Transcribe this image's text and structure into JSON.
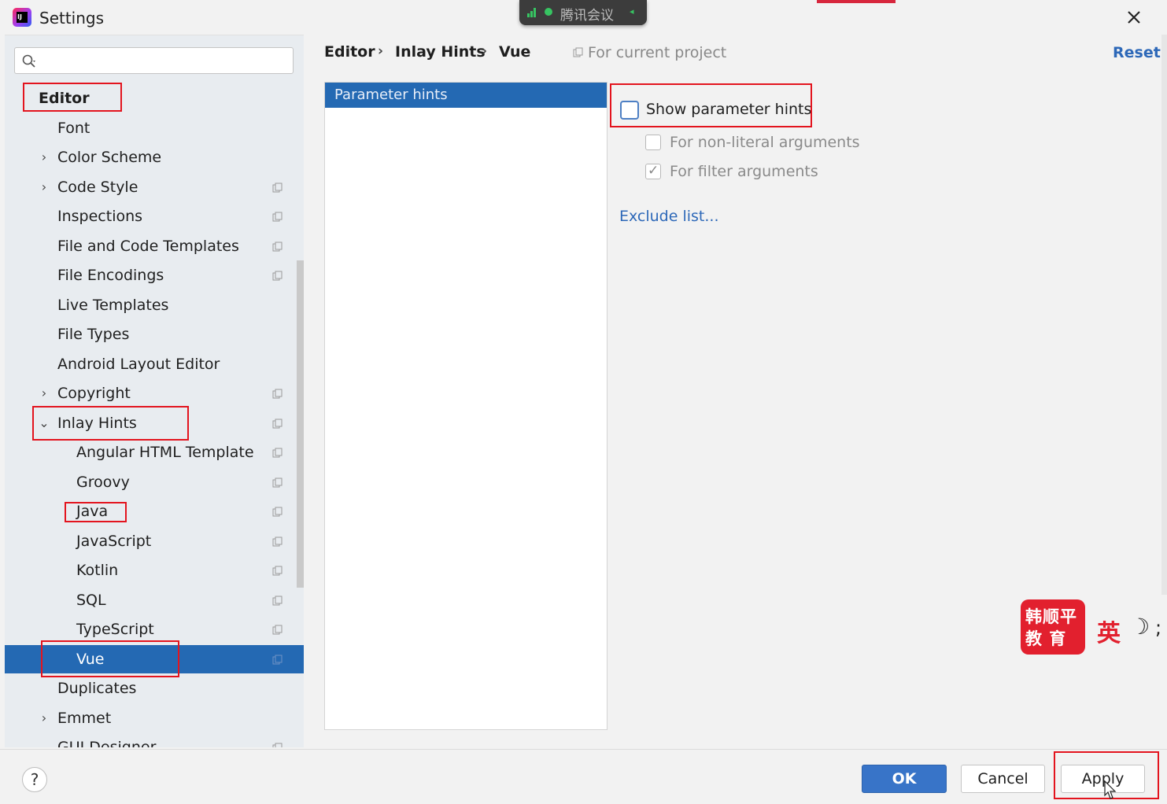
{
  "window": {
    "title": "Settings"
  },
  "meeting_indicator": {
    "text": "腾讯会议"
  },
  "sidebar": {
    "search_placeholder": "",
    "items": [
      {
        "label": "Editor"
      },
      {
        "label": "Font"
      },
      {
        "label": "Color Scheme"
      },
      {
        "label": "Code Style"
      },
      {
        "label": "Inspections"
      },
      {
        "label": "File and Code Templates"
      },
      {
        "label": "File Encodings"
      },
      {
        "label": "Live Templates"
      },
      {
        "label": "File Types"
      },
      {
        "label": "Android Layout Editor"
      },
      {
        "label": "Copyright"
      },
      {
        "label": "Inlay Hints"
      },
      {
        "label": "Angular HTML Template"
      },
      {
        "label": "Groovy"
      },
      {
        "label": "Java"
      },
      {
        "label": "JavaScript"
      },
      {
        "label": "Kotlin"
      },
      {
        "label": "SQL"
      },
      {
        "label": "TypeScript"
      },
      {
        "label": "Vue"
      },
      {
        "label": "Duplicates"
      },
      {
        "label": "Emmet"
      },
      {
        "label": "GUI Designer"
      }
    ]
  },
  "breadcrumb": {
    "items": [
      "Editor",
      "Inlay Hints",
      "Vue"
    ],
    "separator": "›"
  },
  "scope_label": "For current project",
  "reset_label": "Reset",
  "hint_list": {
    "items": [
      "Parameter hints"
    ],
    "selected": "Parameter hints"
  },
  "options": {
    "show_parameter_hints": {
      "label": "Show parameter hints",
      "checked": false
    },
    "non_literal": {
      "label": "For non-literal arguments",
      "checked": false
    },
    "filter_args": {
      "label": "For filter arguments",
      "checked": true
    },
    "exclude_list": "Exclude list..."
  },
  "watermark": {
    "line1": "韩顺平",
    "line2": "教 育",
    "ying": "英",
    "moon": "☽",
    "semi": ";"
  },
  "footer": {
    "help": "?",
    "ok": "OK",
    "cancel": "Cancel",
    "apply": "Apply"
  },
  "colors": {
    "selection": "#2469b3",
    "link": "#2d68b8",
    "annotation": "#e3141e",
    "ok_button": "#3874c8"
  }
}
